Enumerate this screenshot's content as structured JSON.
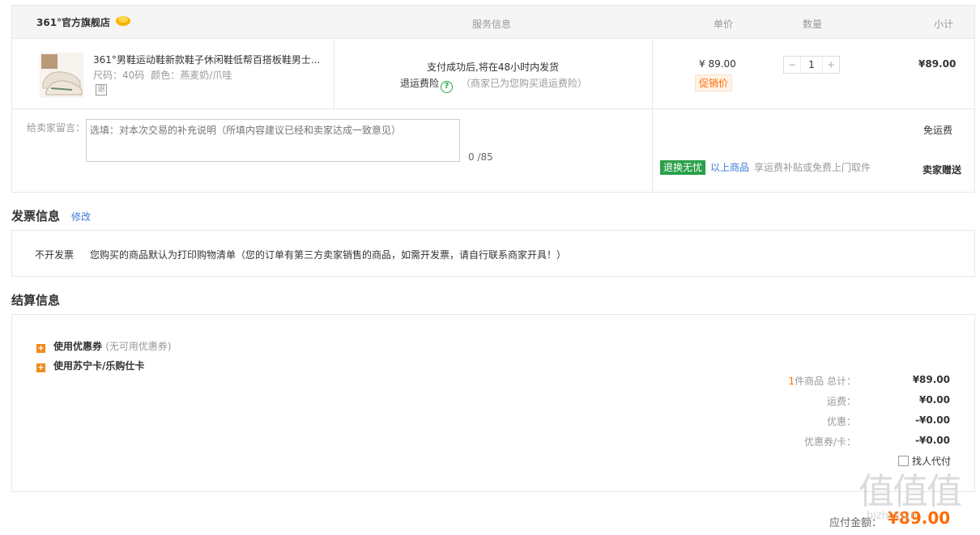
{
  "store": {
    "name": "361°官方旗舰店"
  },
  "columns": {
    "service": "服务信息",
    "price": "单价",
    "qty": "数量",
    "subtotal": "小计"
  },
  "product": {
    "name": "361°男鞋运动鞋新款鞋子休闲鞋低帮百搭板鞋男士...",
    "size": "尺码：40码",
    "color": "颜色：燕麦奶/爪哇",
    "return_badge": "退",
    "service_line1": "支付成功后,将在48小时内发货",
    "service_insurance": "退运费险",
    "service_insurance_note": "（商家已为您购买退运费险）",
    "price": "¥ 89.00",
    "promo": "促销价",
    "qty_minus": "−",
    "qty": "1",
    "qty_plus": "+",
    "subtotal": "¥89.00"
  },
  "message": {
    "label": "给卖家留言：",
    "placeholder": "选填：对本次交易的补充说明（所填内容建议已经和卖家达成一致意见）",
    "count": "0 /85"
  },
  "shipping": {
    "free": "免运费",
    "tag": "退换无忧",
    "above_items": "以上商品",
    "tag_desc": "享运费补贴或免费上门取件",
    "gift": "卖家赠送"
  },
  "invoice": {
    "title": "发票信息",
    "modify": "修改",
    "type": "不开发票",
    "desc": "您购买的商品默认为打印购物清单（您的订单有第三方卖家销售的商品，如需开发票，请自行联系商家开具！）"
  },
  "settlement": {
    "title": "结算信息",
    "coupon_label": "使用优惠券",
    "coupon_hint": "(无可用优惠券)",
    "card_label": "使用苏宁卡/乐购仕卡",
    "total_count": "1",
    "total_label": "件商品 总计：",
    "total_value": "¥89.00",
    "freight_label": "运费：",
    "freight_value": "¥0.00",
    "discount_label": "优惠：",
    "discount_value": "-¥0.00",
    "couponcard_label": "优惠券/卡：",
    "couponcard_value": "-¥0.00",
    "proxy_pay": "找人代付",
    "payable_label": "应付金额：",
    "payable_value": "¥89.00"
  },
  "watermark": {
    "text": "值值值",
    "sub": "hizhi.com"
  },
  "colors": {
    "accent": "#ff6a00",
    "green": "#2aa14a",
    "link": "#3b7bd6"
  }
}
